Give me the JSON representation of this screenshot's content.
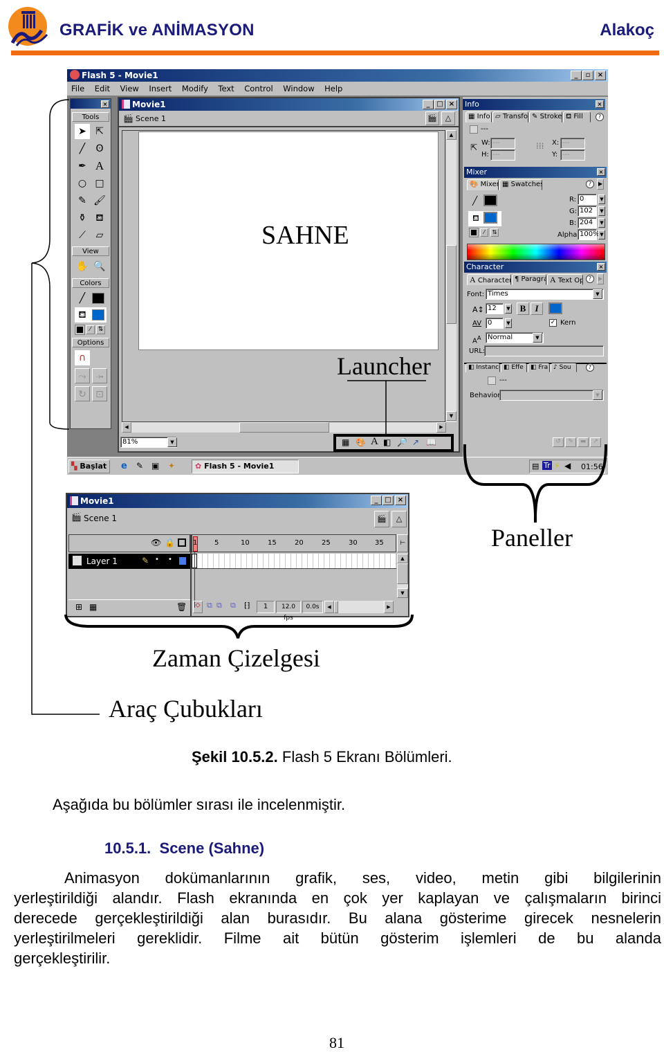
{
  "header": {
    "title": "GRAFİK ve ANİMASYON",
    "author": "Alakoç",
    "logo_alt": "Mersin Üniversitesi 1992",
    "accent_color": "#f26b10",
    "title_color": "#1a1a7a"
  },
  "screenshot": {
    "app_title": "Flash 5 - Movie1",
    "menu": [
      "File",
      "Edit",
      "View",
      "Insert",
      "Modify",
      "Text",
      "Control",
      "Window",
      "Help"
    ],
    "tools_panel": {
      "title": "Tools",
      "view_label": "View",
      "colors_label": "Colors",
      "options_label": "Options"
    },
    "stage_window": {
      "title": "Movie1",
      "scene": "Scene 1",
      "zoom": "81%"
    },
    "info_panel": {
      "title": "Info",
      "tabs": [
        "Info",
        "Transfo",
        "Stroke",
        "Fill"
      ],
      "placeholder": "---",
      "w_label": "W:",
      "h_label": "H:",
      "x_label": "X:",
      "y_label": "Y:",
      "w_value": "---",
      "h_value": "---",
      "x_value": "---",
      "y_value": "---"
    },
    "mixer_panel": {
      "title": "Mixer",
      "tabs": [
        "Mixer",
        "Swatches"
      ],
      "r_label": "R:",
      "g_label": "G:",
      "b_label": "B:",
      "alpha_label": "Alpha:",
      "r": "0",
      "g": "102",
      "b": "204",
      "alpha": "100%",
      "stroke_color": "#000000",
      "fill_color": "#0066cc"
    },
    "character_panel": {
      "title": "Character",
      "tabs": [
        "Character",
        "Paragra",
        "Text Op"
      ],
      "font_label": "Font:",
      "font": "Times",
      "size": "12",
      "tracking": "0",
      "bold": "B",
      "italic": "I",
      "kern_label": "Kern",
      "kern_checked": true,
      "baseline": "Normal",
      "url_label": "URL:",
      "url_value": ""
    },
    "instance_panel": {
      "tabs": [
        "Instance",
        "Effe",
        "Fra",
        "Sou"
      ],
      "placeholder": "---",
      "behavior_label": "Behavior:"
    },
    "taskbar": {
      "start": "Başlat",
      "task": "Flash 5 - Movie1",
      "tray_tr": "Tr",
      "clock": "01:56"
    },
    "timeline_window": {
      "title": "Movie1",
      "scene": "Scene 1",
      "layer": "Layer 1",
      "frame_numbers": [
        "1",
        "5",
        "10",
        "15",
        "20",
        "25",
        "30",
        "35"
      ],
      "current_frame": "1",
      "fps": "12.0 fps",
      "elapsed": "0.0s"
    }
  },
  "annotations": {
    "stage": "SAHNE",
    "launcher": "Launcher",
    "panels": "Paneller",
    "timeline": "Zaman Çizelgesi",
    "toolbars": "Araç Çubukları"
  },
  "figure_caption": {
    "number": "Şekil 10.5.2.",
    "text": "Flash 5 Ekranı Bölümleri."
  },
  "intro": "Aşağıda bu bölümler sırası ile incelenmiştir.",
  "section": {
    "number": "10.5.1.",
    "title": "Scene (Sahne)",
    "paragraph_lines": [
      "Animasyon dokümanlarının grafik, ses, video, metin gibi bilgilerinin",
      "yerleştirildiği alandır. Flash ekranında en çok yer kaplayan ve çalışmaların birinci",
      "derecede gerçekleştirildiği alan burasıdır. Bu alana gösterime girecek nesnelerin",
      "yerleştirilmeleri gereklidir. Filme ait bütün gösterim işlemleri de bu alanda",
      "gerçekleştirilir."
    ]
  },
  "page_number": "81"
}
